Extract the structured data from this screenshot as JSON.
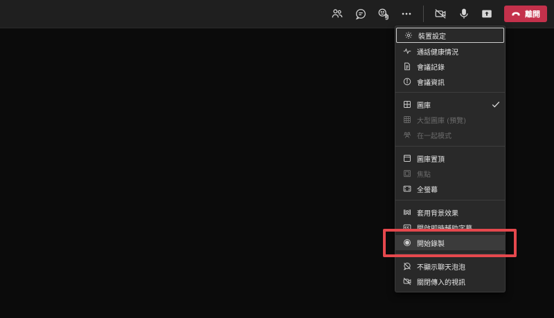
{
  "toolbar": {
    "icons": [
      "participants-icon",
      "chat-icon",
      "reactions-icon",
      "more-actions-icon",
      "camera-off-icon",
      "mic-icon",
      "share-screen-icon"
    ],
    "leave_label": "離開",
    "leave_color": "#c4314b"
  },
  "menu": {
    "items": [
      {
        "label": "裝置設定",
        "icon": "gear-icon",
        "state": "focused"
      },
      {
        "label": "通話健康情況",
        "icon": "pulse-icon"
      },
      {
        "label": "會議記錄",
        "icon": "notes-icon"
      },
      {
        "label": "會議資訊",
        "icon": "info-icon"
      },
      {
        "label": "圖庫",
        "icon": "gallery-icon",
        "checked": true
      },
      {
        "label": "大型圖庫 (預覽)",
        "icon": "large-gallery-icon",
        "disabled": true
      },
      {
        "label": "在一起模式",
        "icon": "together-mode-icon",
        "disabled": true
      },
      {
        "label": "圖庫置頂",
        "icon": "gallery-top-icon"
      },
      {
        "label": "焦點",
        "icon": "focus-icon",
        "disabled": true
      },
      {
        "label": "全螢幕",
        "icon": "fullscreen-icon"
      },
      {
        "label": "套用背景效果",
        "icon": "background-effects-icon"
      },
      {
        "label": "開啟即時輔助字幕",
        "icon": "captions-icon"
      },
      {
        "label": "開始錄製",
        "icon": "record-icon",
        "highlighted": true
      },
      {
        "label": "不顯示聊天泡泡",
        "icon": "chat-bubble-off-icon"
      },
      {
        "label": "關閉傳入的視訊",
        "icon": "video-off-icon"
      }
    ]
  },
  "annotation": {
    "color": "#e5484d"
  }
}
